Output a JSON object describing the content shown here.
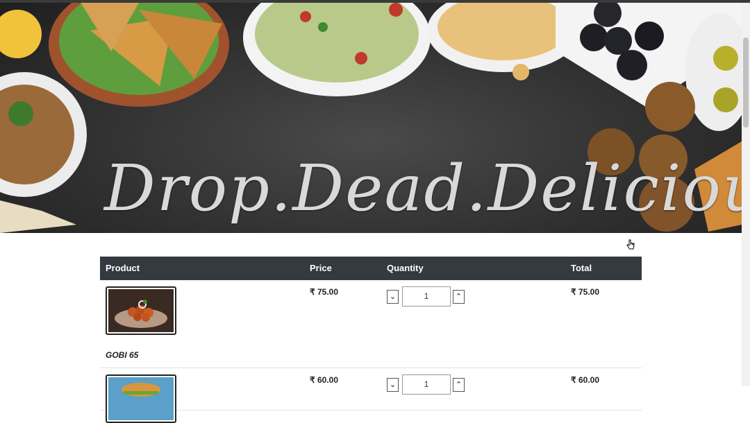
{
  "banner": {
    "title": "Drop.Dead.Delicious."
  },
  "table": {
    "headers": {
      "product": "Product",
      "price": "Price",
      "quantity": "Quantity",
      "total": "Total"
    },
    "rows": [
      {
        "name": "GOBI 65",
        "price": "₹ 75.00",
        "quantity": "1",
        "total": "₹ 75.00"
      },
      {
        "name": "",
        "price": "₹ 60.00",
        "quantity": "1",
        "total": "₹ 60.00"
      }
    ]
  },
  "icons": {
    "decrease": "chevron-down-icon",
    "increase": "chevron-up-icon",
    "cursor": "hand-pointer-icon"
  },
  "colors": {
    "header_bg": "#343a40",
    "header_text": "#ffffff",
    "banner_bg": "#303030"
  }
}
